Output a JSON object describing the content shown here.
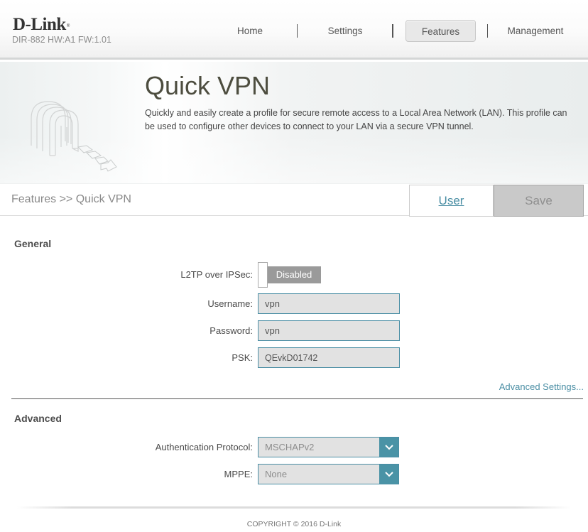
{
  "header": {
    "logo": "D-Link",
    "logo_mark": "®",
    "model_info": "DIR-882 HW:A1 FW:1.01",
    "nav": [
      {
        "label": "Home",
        "active": false
      },
      {
        "label": "Settings",
        "active": false
      },
      {
        "label": "Features",
        "active": true
      },
      {
        "label": "Management",
        "active": false
      }
    ]
  },
  "banner": {
    "icon": "vpn-tunnel-icon",
    "title": "Quick VPN",
    "description": "Quickly and easily create a profile for secure remote access to a Local Area Network (LAN). This profile can be used to configure other devices to connect to your LAN via a secure VPN tunnel."
  },
  "toolbar": {
    "breadcrumb": "Features >> Quick VPN",
    "user_label": "User",
    "save_label": "Save"
  },
  "general": {
    "title": "General",
    "l2tp_label": "L2TP over IPSec:",
    "l2tp_state": "Disabled",
    "username_label": "Username:",
    "username_value": "vpn",
    "password_label": "Password:",
    "password_value": "vpn",
    "psk_label": "PSK:",
    "psk_value": "QEvkD01742",
    "advanced_link": "Advanced Settings..."
  },
  "advanced": {
    "title": "Advanced",
    "auth_label": "Authentication Protocol:",
    "auth_value": "MSCHAPv2",
    "mppe_label": "MPPE:",
    "mppe_value": "None"
  },
  "footer": {
    "copyright": "COPYRIGHT © 2016 D-Link"
  },
  "colors": {
    "accent": "#4a8ea4",
    "select_arrow_bg": "#4a93a6",
    "toggle_disabled": "#9a9a9a",
    "save_disabled_bg": "#c9c9c9"
  }
}
